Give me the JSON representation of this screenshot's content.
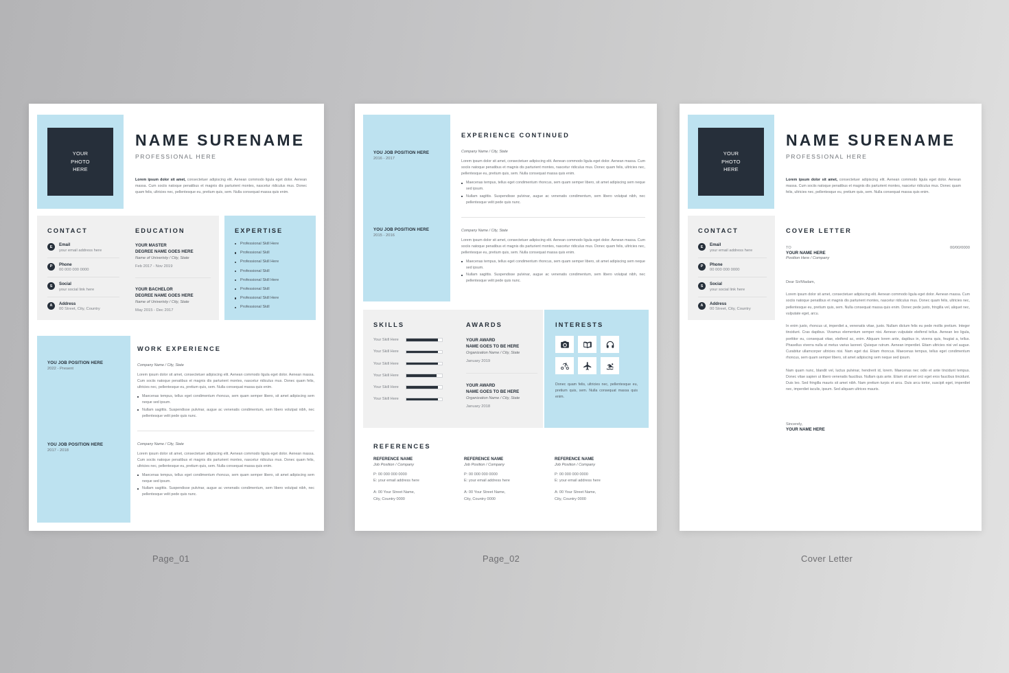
{
  "background": {
    "gradient_from": "#b4b4b6",
    "gradient_to": "#e2e2e2"
  },
  "theme": {
    "accent_blue": "#bde2f0",
    "dark": "#262f3a",
    "panel_grey": "#f0f0f0"
  },
  "captions": {
    "page1": "Page_01",
    "page2": "Page_02",
    "page3": "Cover Letter"
  },
  "header": {
    "photo_line1": "YOUR",
    "photo_line2": "PHOTO",
    "photo_line3": "HERE",
    "name": "NAME SURENAME",
    "role": "PROFESSIONAL HERE",
    "intro_bold": "Lorem ipsum dolor sit amet,",
    "intro_rest": " consectetuer adipiscing elit. Aenean commodo ligula eget dolor. Aenean massa. Cum sociis natoque penatibus et magnis dis parturient montes, nascetur ridiculus mus. Donec quam felis, ultricies nec, pellentesque eu, pretium quis, sem. Nulla consequat massa quis enim."
  },
  "contact": {
    "title": "CONTACT",
    "items": [
      {
        "icon": "envelope-icon",
        "glyph": "E",
        "label": "Email",
        "value": "your email address here"
      },
      {
        "icon": "phone-icon",
        "glyph": "P",
        "label": "Phone",
        "value": "00 000 000 0000"
      },
      {
        "icon": "social-icon",
        "glyph": "S",
        "label": "Social",
        "value": "your social link here"
      },
      {
        "icon": "address-icon",
        "glyph": "A",
        "label": "Address",
        "value": "00 Street, City, Country"
      }
    ]
  },
  "education": {
    "title": "EDUCATION",
    "items": [
      {
        "degree_line1": "YOUR MASTER",
        "degree_line2": "DEGREE NAME GOES HERE",
        "university": "Name of Univeristy / City, State",
        "date": "Feb 2017 - Nov 2019"
      },
      {
        "degree_line1": "YOUR BACHELOR",
        "degree_line2": "DEGREE NAME GOES HERE",
        "university": "Name of Univeristy / City, State",
        "date": "May 2015 - Dec 2017"
      }
    ]
  },
  "expertise": {
    "title": "EXPERTISE",
    "items": [
      "Professional Skill Here",
      "Professional Skill",
      "Professional Skill Here",
      "Professional Skill",
      "Professional Skill Here",
      "Professional Skill",
      "Professional Skill Here",
      "Professional Skill"
    ]
  },
  "work_experience": {
    "title": "WORK EXPERIENCE",
    "jobs": [
      {
        "position": "YOU JOB POSITION HERE",
        "date": "2022 - Present",
        "company": "Company Name / City, State",
        "paragraph": "Lorem ipsum dolor sit amet, consectetuer adipiscing elit. Aenean commodo ligula eget dolor. Aenean massa. Cum sociis natoque penatibus et magnis dis parturient montes, nascetur ridiculus mus. Donec quam felis, ultricies nec, pellentesque eu, pretium quis, sem. Nulla consequat massa quis enim.",
        "bullets": [
          "Maecenas tempus, tellus eget condimentum rhoncus, sem quam semper libero, sit amet adipiscing sem neque sed ipsum.",
          "Nullam sagittis. Suspendisse pulvinar, augue ac venenatis condimentum, sem libero volutpat nibh, nec pellentesque velit pede quis nunc."
        ]
      },
      {
        "position": "YOU JOB POSITION HERE",
        "date": "2017 - 2018",
        "company": "Company Name / City, State",
        "paragraph": "Lorem ipsum dolor sit amet, consectetuer adipiscing elit. Aenean commodo ligula eget dolor. Aenean massa. Cum sociis natoque penatibus et magnis dis parturient montes, nascetur ridiculus mus. Donec quam felis, ultricies nec, pellentesque eu, pretium quis, sem. Nulla consequat massa quis enim.",
        "bullets": [
          "Maecenas tempus, tellus eget condimentum rhoncus, sem quam semper libero, sit amet adipiscing sem neque sed ipsum.",
          "Nullam sagittis. Suspendisse pulvinar, augue ac venenatis condimentum, sem libero volutpat nibh, nec pellentesque velit pede quis nunc."
        ]
      }
    ]
  },
  "experience_continued": {
    "title": "EXPERIENCE CONTINUED",
    "jobs": [
      {
        "position": "YOU JOB POSITION HERE",
        "date": "2016 - 2017",
        "company": "Company Name / City, State",
        "paragraph": "Lorem ipsum dolor sit amet, consectetuer adipiscing elit. Aenean commodo ligula eget dolor. Aenean massa. Cum sociis natoque penatibus et magnis dis parturient montes, nascetur ridiculus mus. Donec quam felis, ultricies nec, pellentesque eu, pretium quis, sem. Nulla consequat massa quis enim.",
        "bullets": [
          "Maecenas tempus, tellus eget condimentum rhoncus, sem quam semper libero, sit amet adipiscing sem neque sed ipsum.",
          "Nullam sagittis. Suspendisse pulvinar, augue ac venenatis condimentum, sem libero volutpat nibh, nec pellentesque velit pede quis nunc."
        ]
      },
      {
        "position": "YOU JOB POSITION HERE",
        "date": "2015 - 2016",
        "company": "Company Name / City, State",
        "paragraph": "Lorem ipsum dolor sit amet, consectetuer adipiscing elit. Aenean commodo ligula eget dolor. Aenean massa. Cum sociis natoque penatibus et magnis dis parturient montes, nascetur ridiculus mus. Donec quam felis, ultricies nec, pellentesque eu, pretium quis, sem. Nulla consequat massa quis enim.",
        "bullets": [
          "Maecenas tempus, tellus eget condimentum rhoncus, sem quam semper libero, sit amet adipiscing sem neque sed ipsum.",
          "Nullam sagittis. Suspendisse pulvinar, augue ac venenatis condimentum, sem libero volutpat nibh, nec pellentesque velit pede quis nunc."
        ]
      }
    ]
  },
  "skills": {
    "title": "SKILLS",
    "items": [
      {
        "name": "Your Skill Here",
        "level": 88
      },
      {
        "name": "Your Skill Here",
        "level": 88
      },
      {
        "name": "Your Skill Here",
        "level": 88
      },
      {
        "name": "Your Skill Here",
        "level": 85
      },
      {
        "name": "Your Skill Here",
        "level": 88
      },
      {
        "name": "Your Skill Here",
        "level": 88
      }
    ]
  },
  "awards": {
    "title": "AWARDS",
    "items": [
      {
        "name_line1": "YOUR AWARD",
        "name_line2": "NAME GOES TO BE HERE",
        "organization": "Organization Name / City, State",
        "date": "January 2019"
      },
      {
        "name_line1": "YOUR AWARD",
        "name_line2": "NAME GOES TO BE HERE",
        "organization": "Organization Name / City, State",
        "date": "January 2018"
      }
    ]
  },
  "interests": {
    "title": "INTERESTS",
    "icons": [
      "camera-icon",
      "book-icon",
      "headphones-icon",
      "bicycle-icon",
      "airplane-icon",
      "swimming-icon"
    ],
    "text": "Donec quam felis, ultricies nec, pellentesque eu, pretium quis, sem. Nulla consequat massa quis enim."
  },
  "references": {
    "title": "REFERENCES",
    "items": [
      {
        "name": "REFERENCE NAME",
        "position": "Job Position / Company",
        "phone": "P: 00 000 000 0000",
        "email": "E: your email address here",
        "address_line1": "A: 00 Your Street Name,",
        "address_line2": "City, Country 0000"
      },
      {
        "name": "REFERENCE NAME",
        "position": "Job Position / Company",
        "phone": "P: 00 000 000 0000",
        "email": "E: your email address here",
        "address_line1": "A: 00 Your Street Name,",
        "address_line2": "City, Country 0000"
      },
      {
        "name": "REFERENCE NAME",
        "position": "Job Position / Company",
        "phone": "P: 00 000 000 0000",
        "email": "E: your email address here",
        "address_line1": "A: 00 Your Street Name,",
        "address_line2": "City, Country 0000"
      }
    ]
  },
  "cover_letter": {
    "title": "COVER LETTER",
    "to_label": "TO",
    "date": "00/00/0000",
    "to_name": "YOUR NAME HERE",
    "to_position": "Position Here / Company",
    "salutation": "Dear Sir/Madam,",
    "paragraph1": "Lorem ipsum dolor sit amet, consectetuer adipiscing elit. Aenean commodo ligula eget dolor. Aenean massa. Cum sociis natoque penatibus et magnis dis parturient montes, nascetur ridiculus mus. Donec quam felis, ultricies nec, pellentesque eu, pretium quis, sem. Nulla consequat massa quis enim. Donec pede justo, fringilla vel, aliquet nec, vulputate eget, arcu.",
    "paragraph2": "In enim justo, rhoncus ut, imperdiet a, venenatis vitae, justo. Nullam dictum felis eu pede mollis pretium. Integer tincidunt. Cras dapibus. Vivamus elementum semper nisi. Aenean vulputate eleifend tellus. Aenean leo ligula, porttitor eu, consequat vitae, eleifend ac, enim. Aliquam lorem ante, dapibus in, viverra quis, feugiat a, tellus. Phasellus viverra nulla ut metus varius laoreet. Quisque rutrum. Aenean imperdiet. Etiam ultricies nisi vel augue. Curabitur ullamcorper ultricies nisi. Nam eget dui. Etiam rhoncus. Maecenas tempus, tellus eget condimentum rhoncus, sem quam semper libero, sit amet adipiscing sem neque sed ipsum.",
    "paragraph3": "Nam quam nunc, blandit vel, luctus pulvinar, hendrerit id, lorem. Maecenas nec odio et ante tincidunt tempus. Donec vitae sapien ut libero venenatis faucibus. Nullam quis ante. Etiam sit amet orci eget eros faucibus tincidunt. Duis leo. Sed fringilla mauris sit amet nibh.  Nam pretium turpis et arcu. Duis arcu tortor, suscipit eget, imperdiet nec, imperdiet iaculis, ipsum. Sed aliquam ultrices mauris.",
    "sign_off": "Sincerely,",
    "sign_name": "YOUR NAME HERE"
  }
}
